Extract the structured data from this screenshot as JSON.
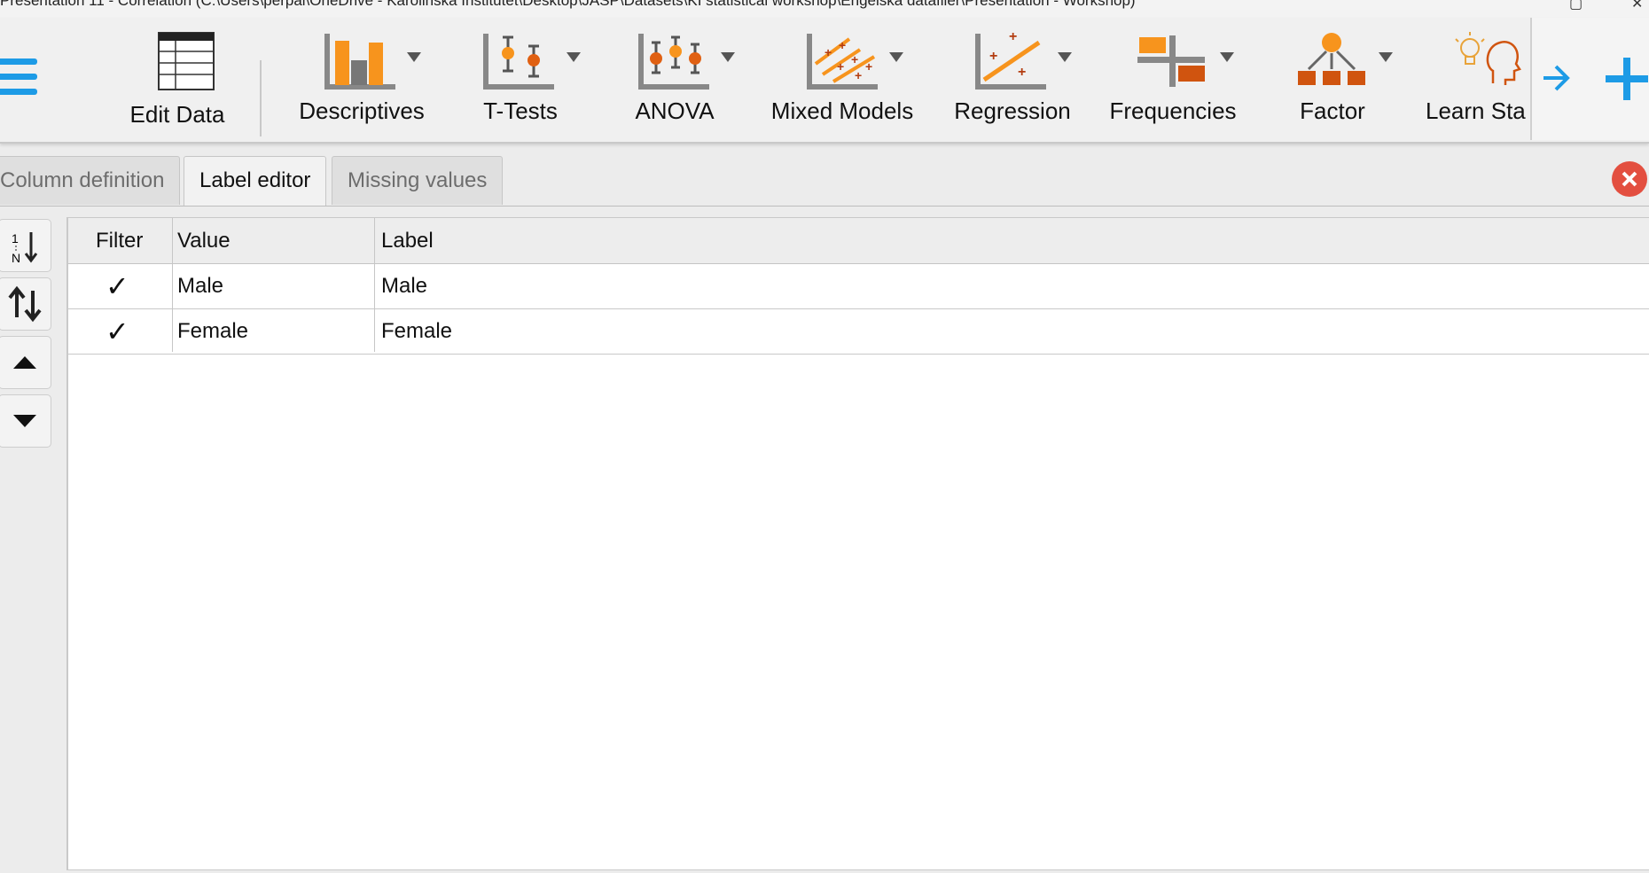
{
  "window": {
    "title": "Presentation 11 - Correlation     (C:\\Users\\perpal\\OneDrive - Karolinska Institutet\\Desktop\\JASP\\Datasets\\KI statistical workshop\\Engelska datafiler\\Presentation - Workshop)"
  },
  "ribbon": {
    "edit_data": "Edit Data",
    "modules": [
      {
        "label": "Descriptives"
      },
      {
        "label": "T-Tests"
      },
      {
        "label": "ANOVA"
      },
      {
        "label": "Mixed Models"
      },
      {
        "label": "Regression"
      },
      {
        "label": "Frequencies"
      },
      {
        "label": "Factor"
      },
      {
        "label": "Learn Sta"
      }
    ]
  },
  "tabs": [
    {
      "label": "Column definition",
      "active": false
    },
    {
      "label": "Label editor",
      "active": true
    },
    {
      "label": "Missing values",
      "active": false
    }
  ],
  "table": {
    "headers": {
      "filter": "Filter",
      "value": "Value",
      "label": "Label"
    },
    "rows": [
      {
        "filter": "✓",
        "value": "Male",
        "label": "Male"
      },
      {
        "filter": "✓",
        "value": "Female",
        "label": "Female"
      }
    ]
  },
  "colors": {
    "accent": "#1d9be6",
    "orange": "#f7941d",
    "close": "#e34f40"
  }
}
